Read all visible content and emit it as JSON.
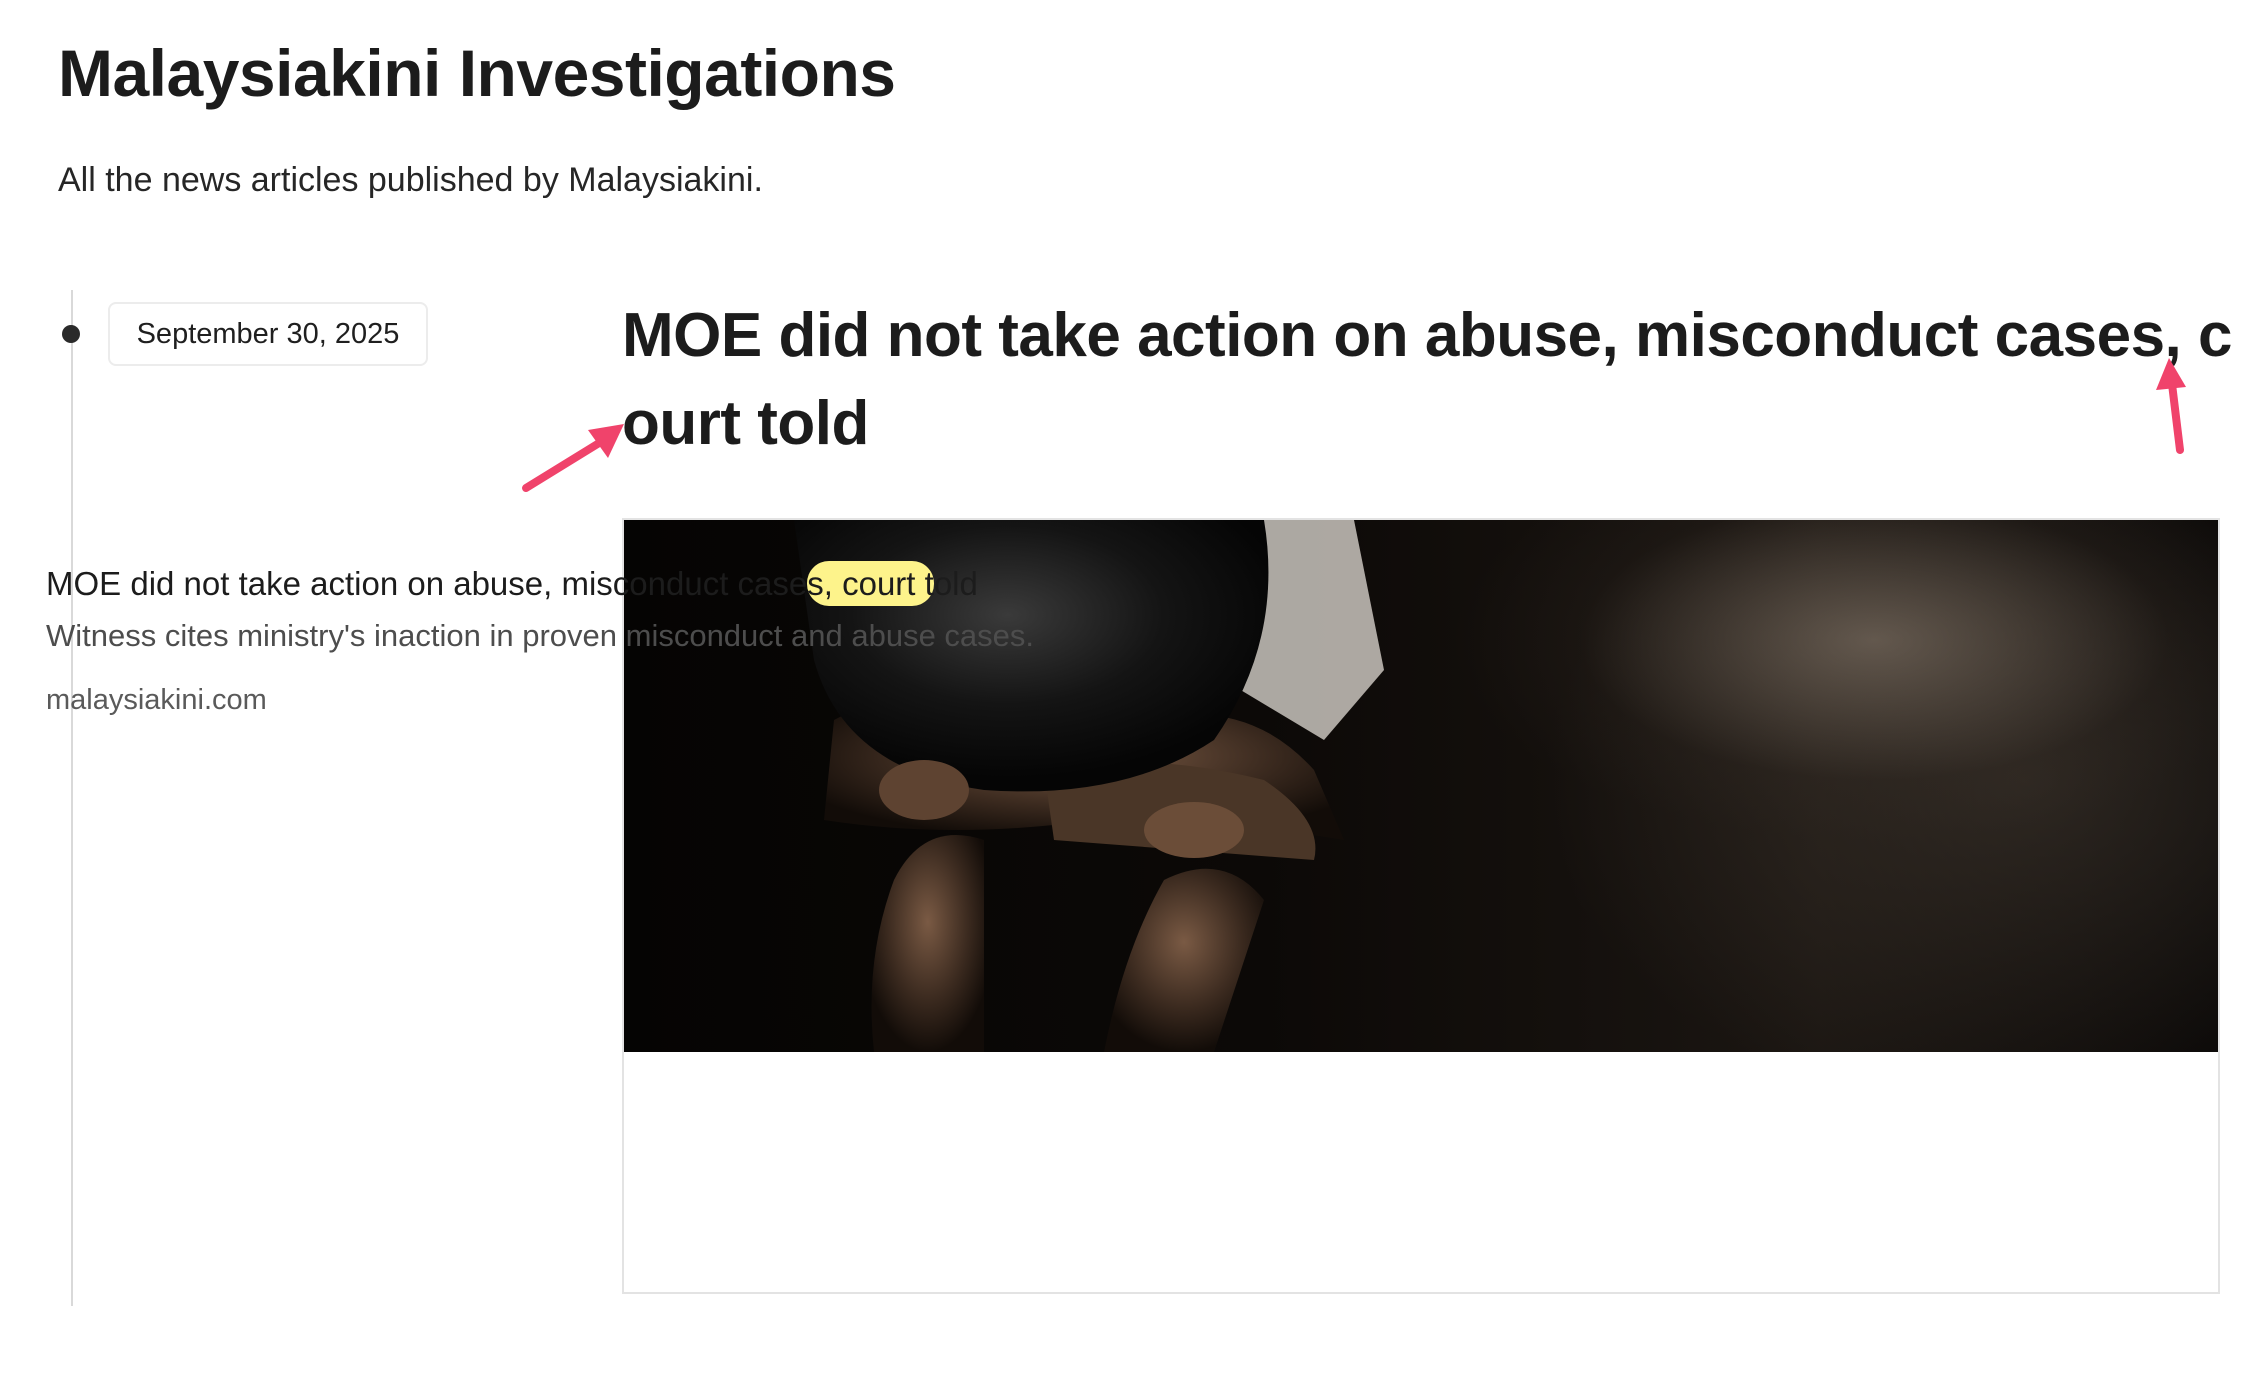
{
  "page": {
    "title": "Malaysiakini Investigations",
    "description": "All the news articles published by Malaysiakini."
  },
  "timeline": {
    "entries": [
      {
        "date": "September 30, 2025",
        "title_line1": "MOE did not take action on abuse, misconduct cases, c",
        "title_line2": "ourt told",
        "card": {
          "image_alt": "Child sitting with head on arms in a dark room",
          "title_before": "MOE did not take action on abuse, misconduct case",
          "title_highlight": "s, court t",
          "title_after": "old",
          "description": "Witness cites ministry's inaction in proven misconduct and abuse cases.",
          "domain": "malaysiakini.com"
        }
      }
    ]
  },
  "annotations": {
    "arrow_color": "#f0436b",
    "highlight_color": "#fdf38b"
  }
}
